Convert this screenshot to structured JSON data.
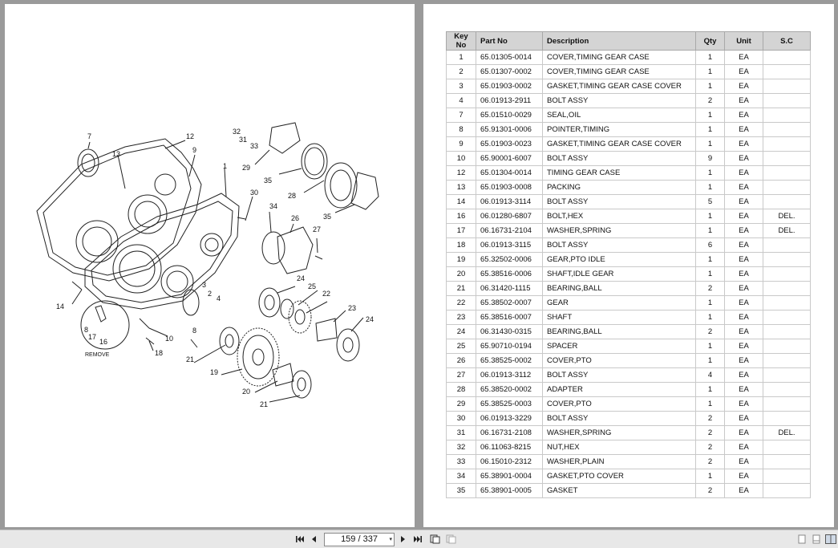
{
  "viewer": {
    "page_display": "159 / 337",
    "icons": [
      "first-page-icon",
      "prev-page-icon",
      "next-page-icon",
      "last-page-icon",
      "fit-width-icon",
      "fit-page-icon",
      "single-page-icon",
      "two-page-icon",
      "two-page-continuous-icon"
    ]
  },
  "diagram": {
    "labels": [
      "7",
      "13",
      "12",
      "9",
      "1",
      "32",
      "31",
      "33",
      "29",
      "30",
      "34",
      "26",
      "27",
      "35",
      "28",
      "35",
      "3",
      "2",
      "4",
      "24",
      "25",
      "22",
      "23",
      "24",
      "14",
      "10",
      "8",
      "18",
      "21",
      "19",
      "20",
      "21",
      "8",
      "17",
      "16",
      "REMOVE"
    ]
  },
  "table": {
    "headers": {
      "key": "Key No",
      "part": "Part No",
      "desc": "Description",
      "qty": "Qty",
      "unit": "Unit",
      "sc": "S.C"
    },
    "rows": [
      {
        "key": "1",
        "part": "65.01305-0014",
        "desc": "COVER,TIMING GEAR CASE",
        "qty": "1",
        "unit": "EA",
        "sc": ""
      },
      {
        "key": "2",
        "part": "65.01307-0002",
        "desc": "COVER,TIMING GEAR CASE",
        "qty": "1",
        "unit": "EA",
        "sc": ""
      },
      {
        "key": "3",
        "part": "65.01903-0002",
        "desc": "GASKET,TIMING GEAR CASE COVER",
        "qty": "1",
        "unit": "EA",
        "sc": ""
      },
      {
        "key": "4",
        "part": "06.01913-2911",
        "desc": "BOLT ASSY",
        "qty": "2",
        "unit": "EA",
        "sc": ""
      },
      {
        "key": "7",
        "part": "65.01510-0029",
        "desc": "SEAL,OIL",
        "qty": "1",
        "unit": "EA",
        "sc": ""
      },
      {
        "key": "8",
        "part": "65.91301-0006",
        "desc": "POINTER,TIMING",
        "qty": "1",
        "unit": "EA",
        "sc": ""
      },
      {
        "key": "9",
        "part": "65.01903-0023",
        "desc": "GASKET,TIMING GEAR CASE COVER",
        "qty": "1",
        "unit": "EA",
        "sc": ""
      },
      {
        "key": "10",
        "part": "65.90001-6007",
        "desc": "BOLT ASSY",
        "qty": "9",
        "unit": "EA",
        "sc": ""
      },
      {
        "key": "12",
        "part": "65.01304-0014",
        "desc": "TIMING GEAR CASE",
        "qty": "1",
        "unit": "EA",
        "sc": ""
      },
      {
        "key": "13",
        "part": "65.01903-0008",
        "desc": "PACKING",
        "qty": "1",
        "unit": "EA",
        "sc": ""
      },
      {
        "key": "14",
        "part": "06.01913-3114",
        "desc": "BOLT ASSY",
        "qty": "5",
        "unit": "EA",
        "sc": ""
      },
      {
        "key": "16",
        "part": "06.01280-6807",
        "desc": "BOLT,HEX",
        "qty": "1",
        "unit": "EA",
        "sc": "DEL."
      },
      {
        "key": "17",
        "part": "06.16731-2104",
        "desc": "WASHER,SPRING",
        "qty": "1",
        "unit": "EA",
        "sc": "DEL."
      },
      {
        "key": "18",
        "part": "06.01913-3115",
        "desc": "BOLT ASSY",
        "qty": "6",
        "unit": "EA",
        "sc": ""
      },
      {
        "key": "19",
        "part": "65.32502-0006",
        "desc": "GEAR,PTO IDLE",
        "qty": "1",
        "unit": "EA",
        "sc": ""
      },
      {
        "key": "20",
        "part": "65.38516-0006",
        "desc": "SHAFT,IDLE GEAR",
        "qty": "1",
        "unit": "EA",
        "sc": ""
      },
      {
        "key": "21",
        "part": "06.31420-1115",
        "desc": "BEARING,BALL",
        "qty": "2",
        "unit": "EA",
        "sc": ""
      },
      {
        "key": "22",
        "part": "65.38502-0007",
        "desc": "GEAR",
        "qty": "1",
        "unit": "EA",
        "sc": ""
      },
      {
        "key": "23",
        "part": "65.38516-0007",
        "desc": "SHAFT",
        "qty": "1",
        "unit": "EA",
        "sc": ""
      },
      {
        "key": "24",
        "part": "06.31430-0315",
        "desc": "BEARING,BALL",
        "qty": "2",
        "unit": "EA",
        "sc": ""
      },
      {
        "key": "25",
        "part": "65.90710-0194",
        "desc": "SPACER",
        "qty": "1",
        "unit": "EA",
        "sc": ""
      },
      {
        "key": "26",
        "part": "65.38525-0002",
        "desc": "COVER,PTO",
        "qty": "1",
        "unit": "EA",
        "sc": ""
      },
      {
        "key": "27",
        "part": "06.01913-3112",
        "desc": "BOLT ASSY",
        "qty": "4",
        "unit": "EA",
        "sc": ""
      },
      {
        "key": "28",
        "part": "65.38520-0002",
        "desc": "ADAPTER",
        "qty": "1",
        "unit": "EA",
        "sc": ""
      },
      {
        "key": "29",
        "part": "65.38525-0003",
        "desc": "COVER,PTO",
        "qty": "1",
        "unit": "EA",
        "sc": ""
      },
      {
        "key": "30",
        "part": "06.01913-3229",
        "desc": "BOLT ASSY",
        "qty": "2",
        "unit": "EA",
        "sc": ""
      },
      {
        "key": "31",
        "part": "06.16731-2108",
        "desc": "WASHER,SPRING",
        "qty": "2",
        "unit": "EA",
        "sc": "DEL."
      },
      {
        "key": "32",
        "part": "06.11063-8215",
        "desc": "NUT,HEX",
        "qty": "2",
        "unit": "EA",
        "sc": ""
      },
      {
        "key": "33",
        "part": "06.15010-2312",
        "desc": "WASHER,PLAIN",
        "qty": "2",
        "unit": "EA",
        "sc": ""
      },
      {
        "key": "34",
        "part": "65.38901-0004",
        "desc": "GASKET,PTO COVER",
        "qty": "1",
        "unit": "EA",
        "sc": ""
      },
      {
        "key": "35",
        "part": "65.38901-0005",
        "desc": "GASKET",
        "qty": "2",
        "unit": "EA",
        "sc": ""
      }
    ]
  }
}
